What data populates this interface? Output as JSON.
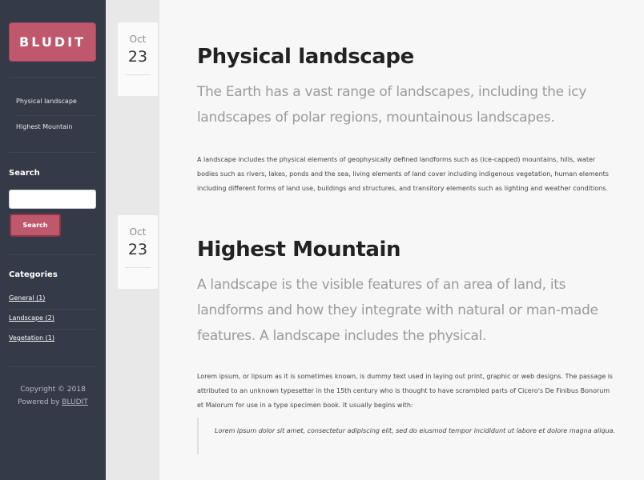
{
  "sidebar": {
    "brand": "BLUDIT",
    "nav": [
      "Physical landscape",
      "Highest Mountain"
    ],
    "search": {
      "heading": "Search",
      "value": "",
      "button": "Search"
    },
    "categories": {
      "heading": "Categories",
      "items": [
        "General (1)",
        "Landscape (2)",
        "Vegetation (1)"
      ]
    },
    "footer": {
      "copyright": "Copyright © 2018",
      "powered_prefix": "Powered by ",
      "powered_link": "BLUDIT"
    }
  },
  "posts": [
    {
      "month": "Oct",
      "day": "23",
      "title": "Physical landscape",
      "lead": "The Earth has a vast range of landscapes, including the icy landscapes of polar regions, mountainous landscapes.",
      "body": "A landscape includes the physical elements of geophysically defined landforms such as (ice-capped) mountains, hills, water bodies such as rivers, lakes, ponds and the sea, living elements of land cover including indigenous vegetation, human elements including different forms of land use, buildings and structures, and transitory elements such as lighting and weather conditions."
    },
    {
      "month": "Oct",
      "day": "23",
      "title": "Highest Mountain",
      "lead": "A landscape is the visible features of an area of land, its landforms and how they integrate with natural or man-made features. A landscape includes the physical.",
      "body": "Lorem ipsum, or lipsum as it is sometimes known, is dummy text used in laying out print, graphic or web designs. The passage is attributed to an unknown typesetter in the 15th century who is thought to have scrambled parts of Cicero's De Finibus Bonorum et Malorum for use in a type specimen book. It usually begins with:",
      "quote": "Lorem ipsum dolor sit amet, consectetur adipiscing elit, sed do eiusmod tempor incididunt ut labore et dolore magna aliqua."
    }
  ]
}
